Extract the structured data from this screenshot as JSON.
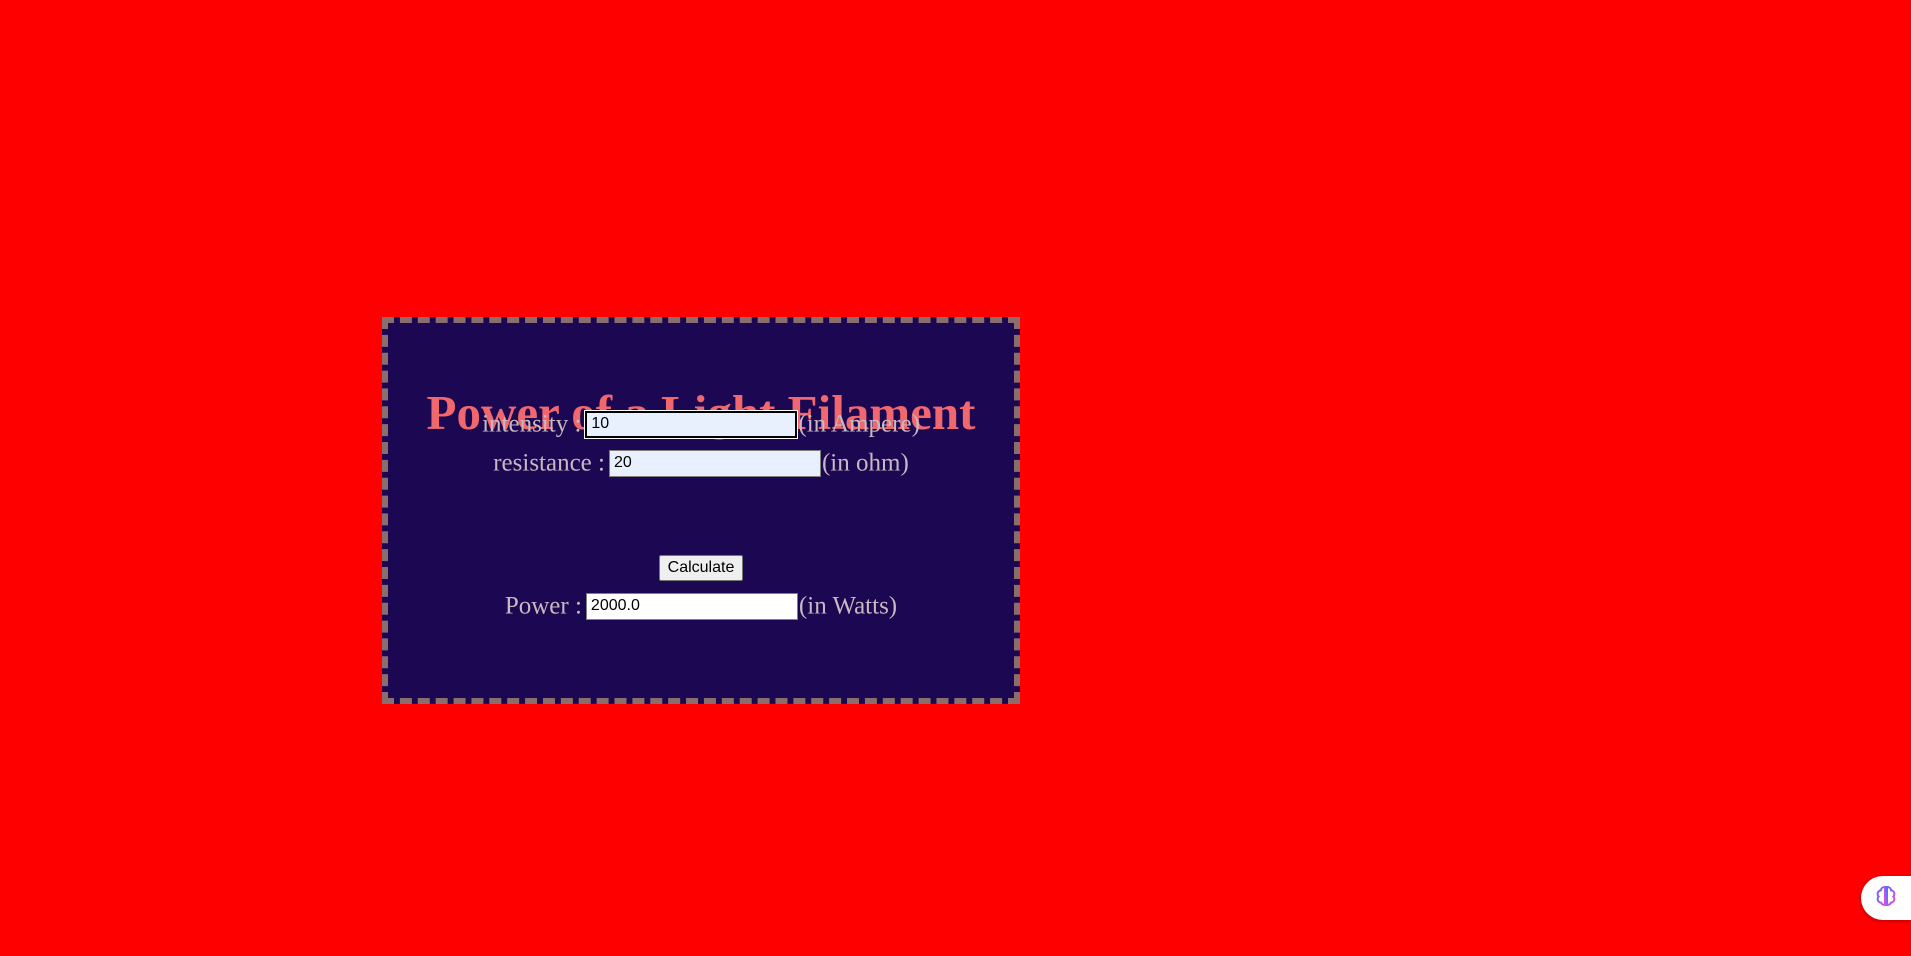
{
  "title": "Power of a Light Filament",
  "form": {
    "intensity": {
      "label": "intensity :",
      "value": "10",
      "unit": "(in Ampere)"
    },
    "resistance": {
      "label": "resistance :",
      "value": "20",
      "unit": "(in ohm)"
    },
    "calculate_label": "Calculate",
    "power": {
      "label": "Power :",
      "value": "2000.0",
      "unit": "(in Watts)"
    }
  },
  "colors": {
    "page_background": "#ff0000",
    "panel_background": "#1c0752",
    "panel_border": "#8a6e6e",
    "title": "#f0676e",
    "label_text": "#c9b8c0"
  },
  "icons": {
    "assistant_badge": "brain-icon"
  }
}
